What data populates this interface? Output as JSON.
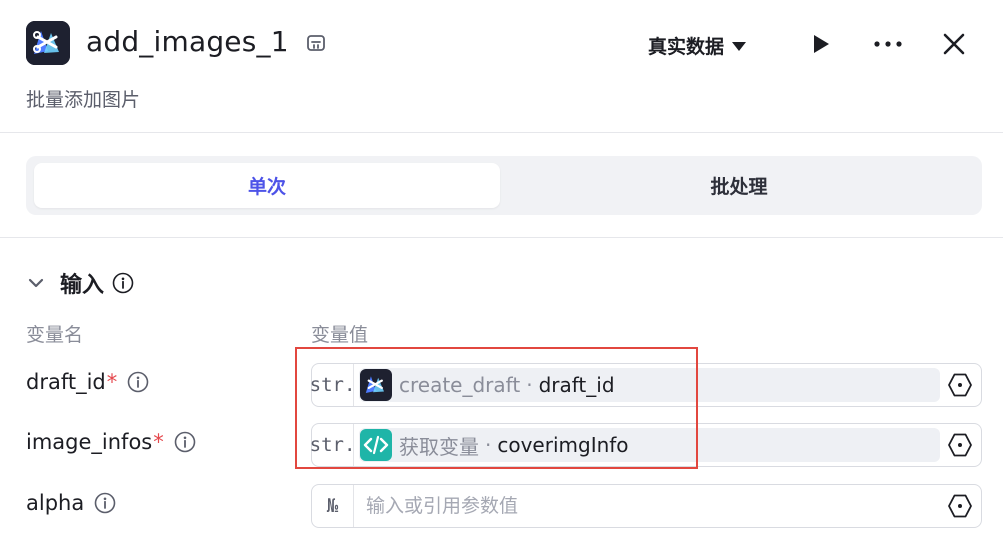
{
  "header": {
    "app_icon": "video-editor-app-icon",
    "title": "add_images_1",
    "title_badge_icon": "plugin-badge-icon",
    "subtitle": "批量添加图片",
    "data_mode_label": "真实数据",
    "run_icon": "play-icon",
    "more_icon": "more-horizontal-icon",
    "close_icon": "close-icon"
  },
  "tabs": {
    "single_label": "单次",
    "batch_label": "批处理",
    "active": "single"
  },
  "input_section": {
    "title": "输入",
    "collapse_icon": "chevron-down-icon",
    "info_icon": "info-icon",
    "col_name_label": "变量名",
    "col_value_label": "变量值",
    "params": [
      {
        "name": "draft_id",
        "required_mark": "*",
        "type_label": "str.",
        "source_icon": "video-editor-app-icon",
        "source_node": "create_draft",
        "separator": "·",
        "source_var": "draft_id"
      },
      {
        "name": "image_infos",
        "required_mark": "*",
        "type_label": "str.",
        "source_icon": "code-icon",
        "source_node": "获取变量",
        "separator": "·",
        "source_var": "coverimgInfo"
      },
      {
        "name": "alpha",
        "required_mark": "",
        "type_label": "№",
        "value": "",
        "placeholder": "输入或引用参数值"
      }
    ]
  },
  "colors": {
    "accent": "#4d53e8",
    "required": "#e5484d",
    "highlight_border": "#e2473f",
    "code_icon_bg": "#1fb5a8",
    "app_icon_bg": "#1e2130"
  }
}
